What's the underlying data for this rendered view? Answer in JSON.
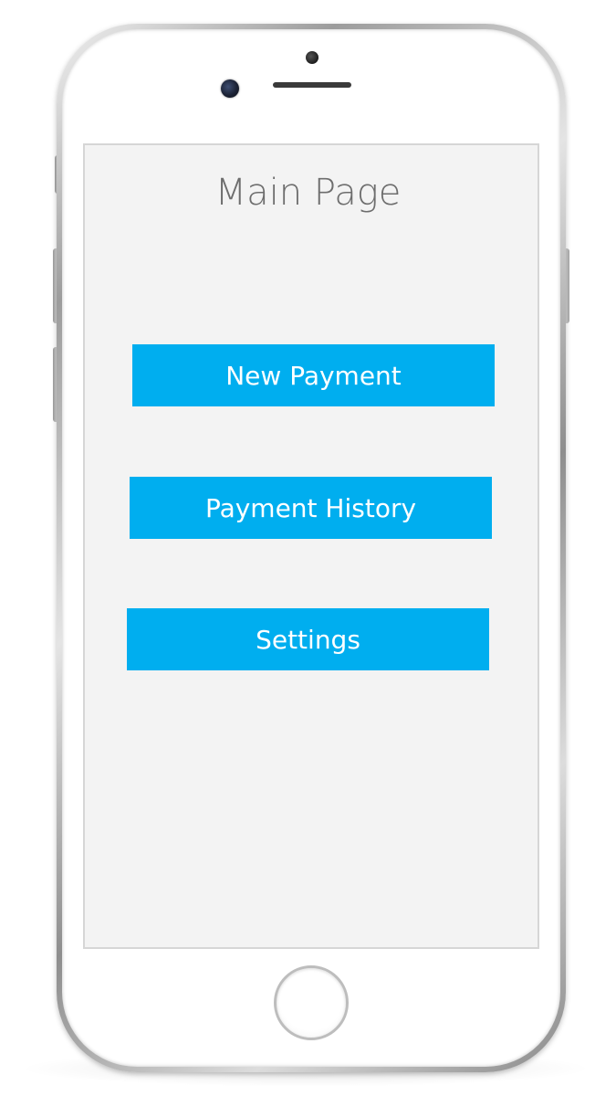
{
  "screen": {
    "title": "Main Page"
  },
  "buttons": {
    "new_payment": "New Payment",
    "payment_history": "Payment History",
    "settings": "Settings"
  },
  "colors": {
    "button_accent": "#00aeef",
    "screen_background": "#f3f3f3",
    "title_text": "#6d6d6d"
  }
}
